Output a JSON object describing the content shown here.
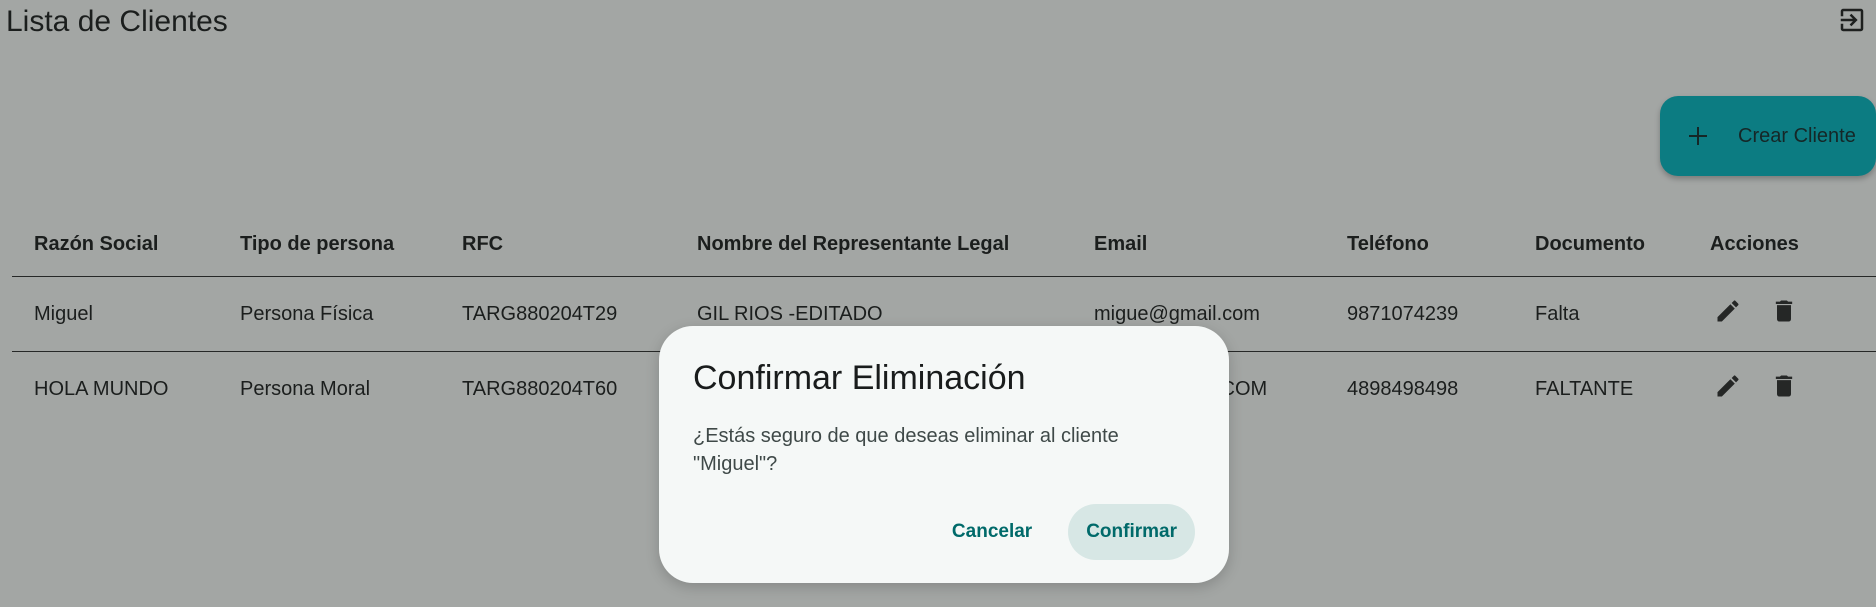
{
  "header": {
    "title": "Lista de Clientes",
    "logout_icon": "logout-icon"
  },
  "fab": {
    "label": "Crear Cliente",
    "icon": "plus-icon",
    "color": "#00b7c3"
  },
  "table": {
    "columns": [
      "Razón Social",
      "Tipo de persona",
      "RFC",
      "Nombre del Representante Legal",
      "Email",
      "Teléfono",
      "Documento",
      "Acciones"
    ],
    "rows": [
      [
        "Miguel",
        "Persona Física",
        "TARG880204T29",
        "GIL RIOS -EDITADO",
        "migue@gmail.com",
        "9871074239",
        "Falta"
      ],
      [
        "HOLA MUNDO",
        "Persona Moral",
        "TARG880204T60",
        "",
        ".COM",
        "4898498498",
        "FALTANTE"
      ]
    ],
    "row_actions": [
      "edit-icon",
      "delete-icon"
    ]
  },
  "dialog": {
    "title": "Confirmar Eliminación",
    "message": "¿Estás seguro de que deseas eliminar al cliente \"Miguel\"?",
    "cancel_label": "Cancelar",
    "confirm_label": "Confirmar",
    "accent_color": "#006a6a"
  }
}
